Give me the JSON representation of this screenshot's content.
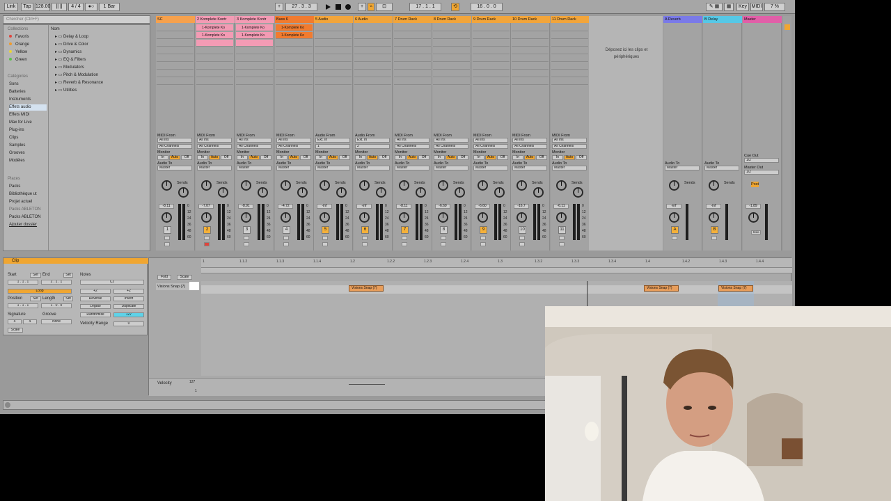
{
  "transport": {
    "link": "Link",
    "tap": "Tap",
    "tempo": "128.00",
    "signature": "4 / 4",
    "quantize": "1 Bar",
    "position": "27 . 3 . 3",
    "loop_start": "17 . 1 . 1",
    "loop_length": "16 . 0 . 0",
    "key": "Key",
    "midi": "MIDI",
    "cpu": "7 %"
  },
  "browser": {
    "search_placeholder": "Chercher (Ctrl+F)",
    "collections_header": "Collections",
    "collections": [
      {
        "label": "Favoris",
        "color": "#e0443c"
      },
      {
        "label": "Orange",
        "color": "#f09a2b"
      },
      {
        "label": "Yellow",
        "color": "#e8d43a"
      },
      {
        "label": "Green",
        "color": "#59c24c"
      }
    ],
    "categories_header": "Catégories",
    "categories": [
      "Sons",
      "Batteries",
      "Instruments",
      "Effets audio",
      "Effets MIDI",
      "Max for Live",
      "Plug-ins",
      "Clips",
      "Samples",
      "Grooves",
      "Modèles"
    ],
    "places_header": "Places",
    "places": [
      "Packs",
      "Bibliothèque ut",
      "Projet actuel",
      "Packs ABLETON",
      "Packs ABLETON",
      "Ajouter dossier"
    ],
    "name_header": "Nom",
    "names": [
      "Delay & Loop",
      "Drive & Color",
      "Dynamics",
      "EQ & Filters",
      "Modulators",
      "Pitch & Modulation",
      "Reverb & Resonance",
      "Utilities"
    ]
  },
  "tracks": [
    {
      "name": "SC",
      "color": "#f6a14d",
      "clips": [],
      "num": "1",
      "vol": "-8.11",
      "input_type": "MIDI From",
      "input": "All Ins",
      "channel": "All Channels",
      "num_on": false
    },
    {
      "name": "2 Komplete Kontr",
      "color": "#f39bb4",
      "clips": [
        "1-Komplete Ko",
        "1-Komplete Ko",
        ""
      ],
      "num": "2",
      "vol": "-7.07",
      "input_type": "MIDI From",
      "input": "All Ins",
      "channel": "All Channels",
      "num_on": true
    },
    {
      "name": "3 Komplete Kontr",
      "color": "#f39bb4",
      "clips": [
        "1-Komplete Ko",
        "1-Komplete Ko",
        ""
      ],
      "num": "3",
      "vol": "-8.91",
      "input_type": "MIDI From",
      "input": "All Ins",
      "channel": "All Channels",
      "num_on": false
    },
    {
      "name": "Bass 6",
      "color": "#f17b2f",
      "clips": [
        "1-Komplete Ko",
        "1-Komplete Ko"
      ],
      "num": "4",
      "vol": "-4.72",
      "input_type": "MIDI From",
      "input": "All Ins",
      "channel": "All Channels",
      "num_on": false
    },
    {
      "name": "5 Audio",
      "color": "#f2a53b",
      "clips": [],
      "num": "5",
      "vol": "-inf",
      "input_type": "Audio From",
      "input": "Ext. In",
      "channel": "1",
      "num_on": true
    },
    {
      "name": "6 Audio",
      "color": "#f2a53b",
      "clips": [],
      "num": "6",
      "vol": "-inf",
      "input_type": "Audio From",
      "input": "Ext. In",
      "channel": "2",
      "num_on": true
    },
    {
      "name": "7 Drum Rack",
      "color": "#f2a53b",
      "clips": [],
      "num": "7",
      "vol": "-8.11",
      "input_type": "MIDI From",
      "input": "All Ins",
      "channel": "All Channels",
      "num_on": true
    },
    {
      "name": "8 Drum Rack",
      "color": "#f2a53b",
      "clips": [],
      "num": "8",
      "vol": "-6.69",
      "input_type": "MIDI From",
      "input": "All Ins",
      "channel": "All Channels",
      "num_on": false
    },
    {
      "name": "9 Drum Rack",
      "color": "#f2a53b",
      "clips": [],
      "num": "9",
      "vol": "-6.60",
      "input_type": "MIDI From",
      "input": "All Ins",
      "channel": "All Channels",
      "num_on": true
    },
    {
      "name": "10 Drum Rack",
      "color": "#f2a53b",
      "clips": [],
      "num": "10",
      "vol": "-16.7",
      "input_type": "MIDI From",
      "input": "All Ins",
      "channel": "All Channels",
      "num_on": false
    },
    {
      "name": "11 Drum Rack",
      "color": "#f2a53b",
      "clips": [],
      "num": "11",
      "vol": "-6.11",
      "input_type": "MIDI From",
      "input": "All Ins",
      "channel": "All Channels",
      "num_on": false
    }
  ],
  "drop_zone": "Déposez ici les clips et périphériques",
  "returns": [
    {
      "name": "A Reverb",
      "color": "#7a7ae8",
      "num": "A",
      "vol": "-inf"
    },
    {
      "name": "B Delay",
      "color": "#56c8e6",
      "num": "B",
      "vol": "-inf"
    }
  ],
  "master": {
    "name": "Master",
    "color": "#e15fa8",
    "vol": "-1.89",
    "cue": "Cue Out",
    "cue_val": "1/2",
    "master_out": "Master Out",
    "master_val": "1/2",
    "solo": "Solo"
  },
  "mixer_labels": {
    "monitor": "Monitor",
    "in": "In",
    "auto": "Auto",
    "off": "Off",
    "audio_to": "Audio To",
    "master": "Master",
    "sends": "Sends",
    "post": "Post",
    "scale": [
      "0",
      "12",
      "24",
      "36",
      "48",
      "60"
    ]
  },
  "clip_detail": {
    "title": "Clip",
    "start": "Start",
    "set": "Set",
    "end": "End",
    "start_val": "1 . 1 . 1",
    "end_val": "2 . 1 . 1",
    "loop": "Loop",
    "position": "Position",
    "length": "Length",
    "position_val": "1 . 1 . 1",
    "length_val": "1 . 0 . 0",
    "signature": "Signature",
    "groove": "Groove",
    "sig_num": "4",
    "sig_den": "4",
    "groove_val": "None",
    "scale": "Scale",
    "notes": "Notes",
    "note_val": "C2",
    "plus2": "+2",
    "reverse": "Reverse",
    "invert": "Invert",
    "legato": "Legato",
    "duplicate": "Duplicate",
    "randomize": "Randomize",
    "rand_val": "127",
    "vel_range": "Velocity Range",
    "vel_range_val": "0"
  },
  "editor": {
    "fold": "Fold",
    "scale": "Scale",
    "lane": "Visions Snap (7)",
    "ruler": [
      "1",
      "1.1.2",
      "1.1.3",
      "1.1.4",
      "1.2",
      "1.2.2",
      "1.2.3",
      "1.2.4",
      "1.3",
      "1.3.2",
      "1.3.3",
      "1.3.4",
      "1.4",
      "1.4.2",
      "1.4.3",
      "1.4.4"
    ],
    "notes": [
      "Visions Snap (7)",
      "Visions Snap (7)",
      "Visions Snap (7)"
    ],
    "velocity": "Velocity",
    "vel_max": "127",
    "vel_min": "1"
  }
}
